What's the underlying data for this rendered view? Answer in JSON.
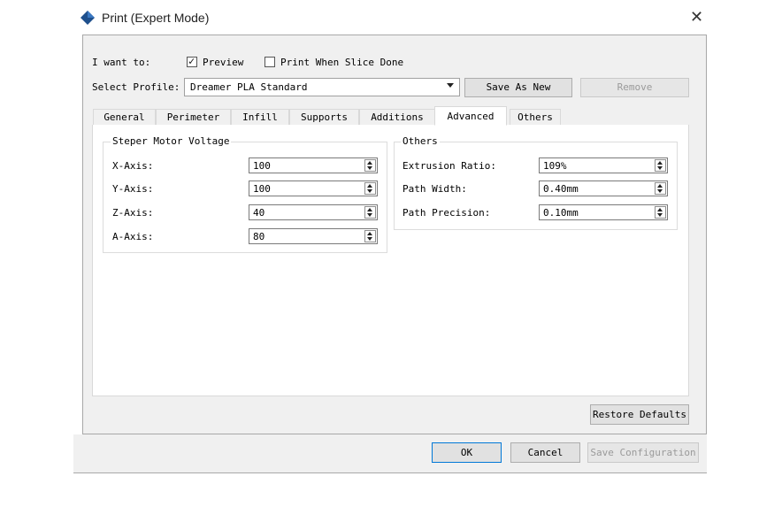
{
  "window": {
    "title": "Print (Expert Mode)",
    "close_glyph": "✕"
  },
  "intent": {
    "label": "I want to:",
    "preview": {
      "label": "Preview",
      "checked": true
    },
    "print_when_done": {
      "label": "Print When Slice Done",
      "checked": false
    }
  },
  "profile": {
    "label": "Select Profile:",
    "selected": "Dreamer PLA Standard",
    "save_as_new": "Save As New",
    "remove": "Remove"
  },
  "tabs": [
    {
      "label": "General"
    },
    {
      "label": "Perimeter"
    },
    {
      "label": "Infill"
    },
    {
      "label": "Supports"
    },
    {
      "label": "Additions"
    },
    {
      "label": "Advanced",
      "active": true
    },
    {
      "label": "Others"
    }
  ],
  "motor_voltage": {
    "title": "Steper Motor Voltage",
    "rows": [
      {
        "label": "X-Axis:",
        "value": "100"
      },
      {
        "label": "Y-Axis:",
        "value": "100"
      },
      {
        "label": "Z-Axis:",
        "value": "40"
      },
      {
        "label": "A-Axis:",
        "value": "80"
      }
    ]
  },
  "others_group": {
    "title": "Others",
    "rows": [
      {
        "label": "Extrusion Ratio:",
        "value": "109%"
      },
      {
        "label": "Path Width:",
        "value": "0.40mm"
      },
      {
        "label": "Path Precision:",
        "value": "0.10mm"
      }
    ]
  },
  "buttons": {
    "restore_defaults": "Restore Defaults",
    "ok": "OK",
    "cancel": "Cancel",
    "save_configuration": "Save Configuration"
  },
  "icons": {
    "app": "diamond-logo-icon"
  },
  "colors": {
    "accent": "#0078d7",
    "logo": "#1e4f8c"
  }
}
